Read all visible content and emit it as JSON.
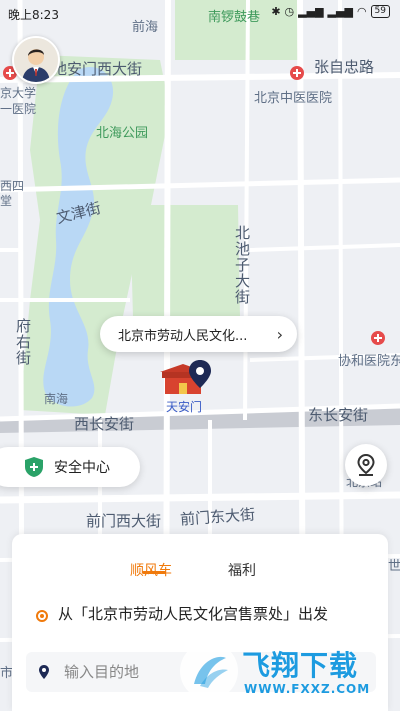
{
  "status_bar": {
    "time": "晚上8:23",
    "battery": "59"
  },
  "map": {
    "labels": {
      "qianhai": "前海",
      "nanluoguxiang": "南锣鼓巷",
      "zhangzizhong": "张自忠路",
      "dianmen": "地安门西大街",
      "beida": "京大学",
      "beida2": "一医院",
      "zhongyi": "北京中医医院",
      "beihai": "北海公园",
      "xisi": "西四",
      "xisi2": "堂",
      "wenjin": "文津街",
      "beichizi": "北池子大街",
      "fuyou": "府右街",
      "xiehe": "协和医院东",
      "nanhai": "南海",
      "tiananmen": "天安门",
      "xichangan": "西长安街",
      "dongchangan": "东长安街",
      "beijingzhan": "北京站",
      "qianmenxi": "前门西大街",
      "qianmendong": "前门东大街",
      "shijie": "世界",
      "shi": "市"
    }
  },
  "callout": {
    "text": "北京市劳动人民文化..."
  },
  "safety_center": {
    "label": "安全中心"
  },
  "panel": {
    "tabs": [
      {
        "label": "顺风车",
        "active": true
      },
      {
        "label": "福利",
        "active": false
      }
    ],
    "from_text": "从「北京市劳动人民文化宫售票处」出发",
    "destination_placeholder": "输入目的地"
  },
  "watermark": {
    "title": "飞翔下载",
    "url": "WWW.FXXZ.COM"
  },
  "colors": {
    "accent": "#f07a0c",
    "map_green": "#cfe8c7",
    "map_water": "#b8d9f7"
  }
}
